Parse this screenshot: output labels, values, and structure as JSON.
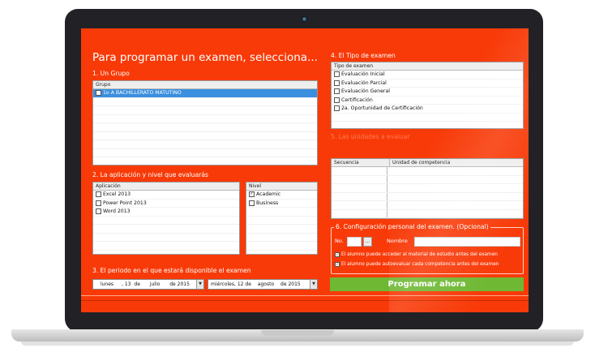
{
  "title": "Para programar un examen, selecciona...",
  "section1": {
    "label": "1. Un Grupo",
    "column": "Grupo",
    "rows": [
      {
        "text": "1o A BACHILLERATO MATUTINO",
        "checked": false,
        "selected": true
      }
    ]
  },
  "section2": {
    "label": "2. La aplicación y nivel que evaluarás",
    "app_column": "Aplicación",
    "apps": [
      {
        "text": "Excel 2013",
        "checked": false
      },
      {
        "text": "Power Point 2013",
        "checked": false
      },
      {
        "text": "Word 2013",
        "checked": false
      }
    ],
    "level_column": "Nivel",
    "levels": [
      {
        "text": "Academic",
        "checked": true
      },
      {
        "text": "Business",
        "checked": false
      }
    ]
  },
  "section3": {
    "label": "3. El periodo en el que estará disponible el examen",
    "start": {
      "weekday": "lunes",
      "day": "13",
      "sep": "de",
      "month": "julio",
      "year_sep": "de",
      "year": "2015"
    },
    "end": {
      "weekday": "miércoles,",
      "day": "12",
      "sep": "de",
      "month": "agosto",
      "year_sep": "de",
      "year": "2015"
    }
  },
  "section4": {
    "label": "4. El Tipo de examen",
    "column": "Tipo de examen",
    "rows": [
      {
        "text": "Evaluación Inicial",
        "checked": false
      },
      {
        "text": "Evaluación Parcial",
        "checked": false
      },
      {
        "text": "Evaluación General",
        "checked": false
      },
      {
        "text": "Certificación",
        "checked": false
      },
      {
        "text": "2a. Oportunidad de Certificación",
        "checked": false
      }
    ]
  },
  "section5": {
    "label": "5. Las unidades a evaluar",
    "col_seq": "Secuencia",
    "col_unit": "Unidad de competencia"
  },
  "section6": {
    "label": "6. Configuración personal del examen. (Opcional)",
    "no_label": "No.",
    "dots": "...",
    "name_label": "Nombre",
    "options": [
      {
        "text": "El alumno puede acceder al material de estudio antes del examen",
        "checked": true
      },
      {
        "text": "El alumno puede autoevaluar cada competencia antes del examen",
        "checked": true
      }
    ]
  },
  "action": {
    "label": "Programar ahora"
  },
  "colors": {
    "screen": "#f83a08",
    "button": "#6fb834",
    "selection": "#3a8fde",
    "bezel": "#222226"
  },
  "icons": {
    "dropdown": "triangle-down-icon",
    "checkbox": "checkbox-icon",
    "camera": "webcam-icon"
  }
}
